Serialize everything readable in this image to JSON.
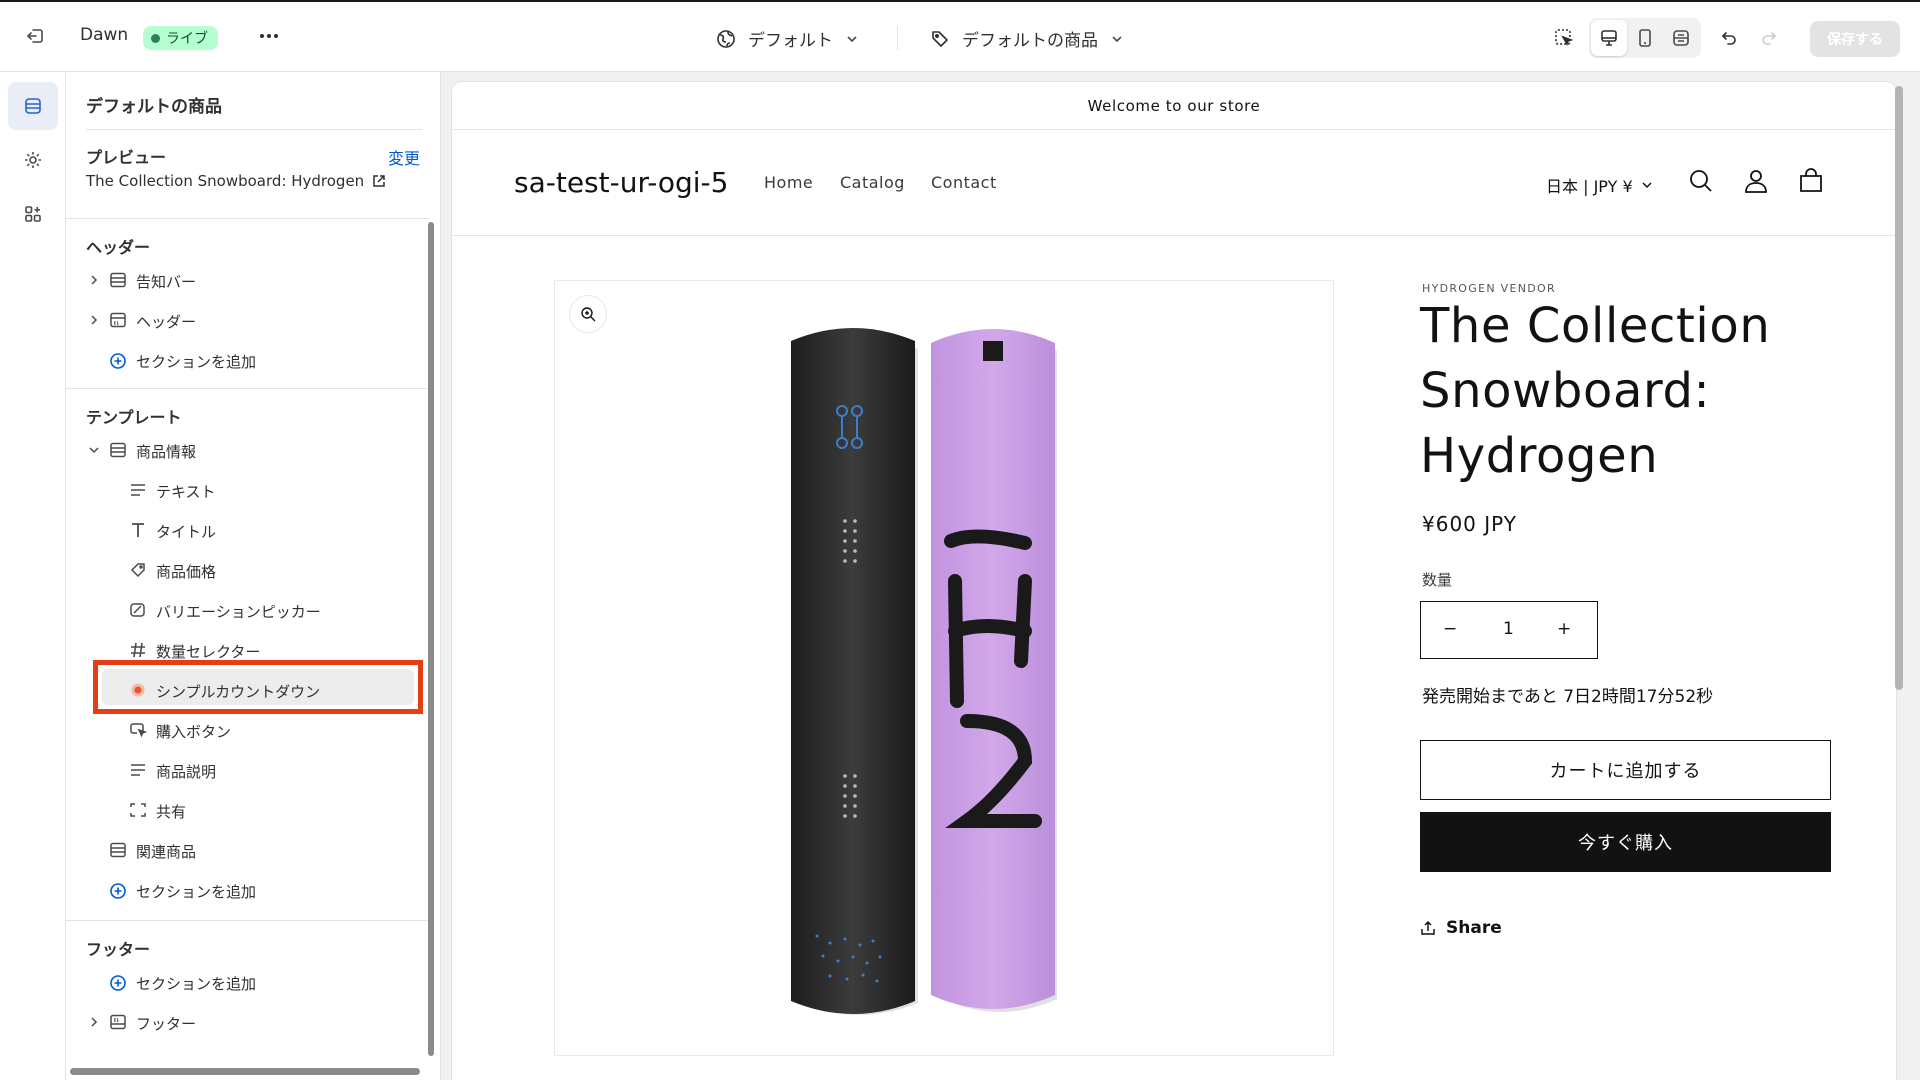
{
  "topbar": {
    "theme_name": "Dawn",
    "live_badge": "ライブ",
    "more_icon": "ellipsis-icon",
    "template_dropdown": "デフォルト",
    "page_dropdown": "デフォルトの商品",
    "save_label": "保存する"
  },
  "rail": {
    "items": [
      {
        "icon": "sections-icon"
      },
      {
        "icon": "settings-icon"
      },
      {
        "icon": "apps-icon"
      }
    ]
  },
  "panel": {
    "title": "デフォルトの商品",
    "preview_label": "プレビュー",
    "preview_change": "変更",
    "preview_product": "The Collection Snowboard: Hydrogen",
    "header_section": "ヘッダー",
    "header_items": [
      "告知バー",
      "ヘッダー"
    ],
    "add_section": "セクションを追加",
    "template_section": "テンプレート",
    "product_info": "商品情報",
    "blocks": [
      "テキスト",
      "タイトル",
      "商品価格",
      "バリエーションピッカー",
      "数量セレクター",
      "シンプルカウントダウン",
      "購入ボタン",
      "商品説明",
      "共有"
    ],
    "related_products": "関連商品",
    "footer_section": "フッター",
    "footer_item": "フッター"
  },
  "store": {
    "announcement": "Welcome to our store",
    "logo": "sa-test-ur-ogi-5",
    "nav": [
      "Home",
      "Catalog",
      "Contact"
    ],
    "locale": "日本 | JPY ¥",
    "product": {
      "vendor": "HYDROGEN VENDOR",
      "title": "The Collection Snowboard: Hydrogen",
      "price": "¥600 JPY",
      "qty_label": "数量",
      "qty_minus": "−",
      "qty_value": "1",
      "qty_plus": "+",
      "countdown": "発売開始まであと 7日2時間17分52秒",
      "add_to_cart": "カートに追加する",
      "buy_now": "今すぐ購入",
      "share": "Share"
    }
  }
}
